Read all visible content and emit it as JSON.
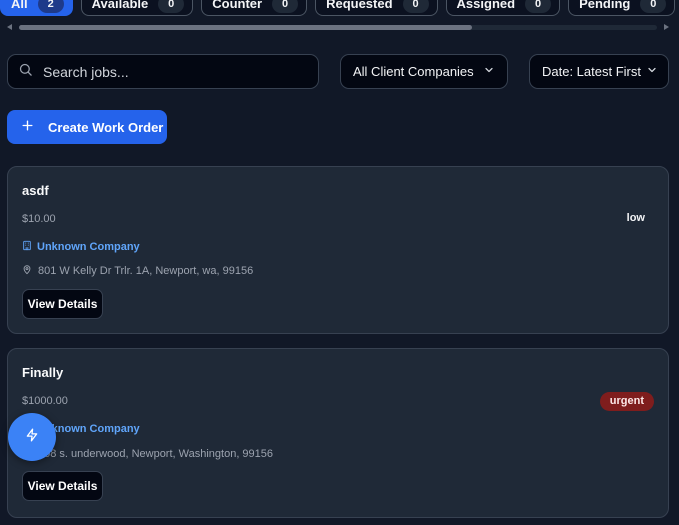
{
  "tabs": [
    {
      "label": "All",
      "count": "2",
      "active": true
    },
    {
      "label": "Available",
      "count": "0"
    },
    {
      "label": "Counter",
      "count": "0"
    },
    {
      "label": "Requested",
      "count": "0"
    },
    {
      "label": "Assigned",
      "count": "0"
    },
    {
      "label": "Pending",
      "count": "0"
    }
  ],
  "filters": {
    "search_placeholder": "Search jobs...",
    "company_select": "All Client Companies",
    "sort_select": "Date: Latest First"
  },
  "actions": {
    "create_label": "Create Work Order"
  },
  "jobs": [
    {
      "title": "asdf",
      "price": "$10.00",
      "company": "Unknown Company",
      "address": "801 W Kelly Dr Trlr. 1A, Newport, wa, 99156",
      "priority": "low",
      "details_label": "View Details"
    },
    {
      "title": "Finally",
      "price": "$1000.00",
      "company": "Unknown Company",
      "address": "108 s. underwood, Newport, Washington, 99156",
      "priority": "urgent",
      "details_label": "View Details"
    }
  ],
  "icons": {
    "search": "search-icon",
    "chevron": "chevron-down-icon",
    "plus": "plus-icon",
    "company": "building-icon",
    "address": "map-pin-icon",
    "fab": "zap-icon"
  },
  "colors": {
    "background": "#111827",
    "card": "#1f2937",
    "accent": "#2563eb",
    "link": "#60a5fa",
    "urgent": "#7f1d1d",
    "fab": "#3b82f6"
  }
}
